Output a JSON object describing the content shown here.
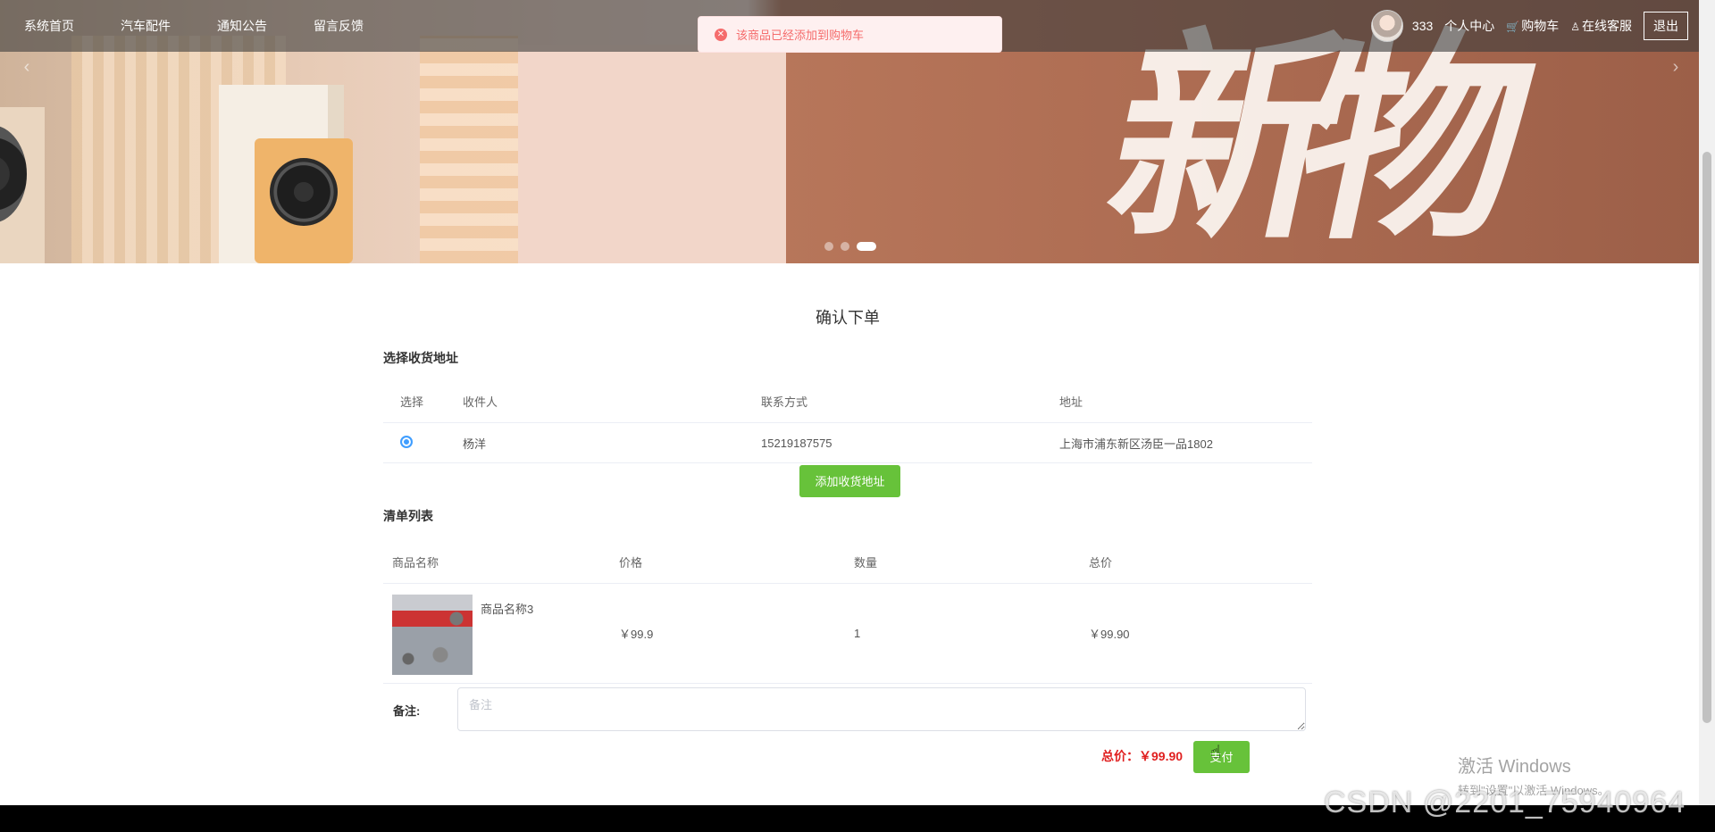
{
  "nav": {
    "menu": [
      "系统首页",
      "汽车配件",
      "通知公告",
      "留言反馈"
    ],
    "username": "333",
    "personal_center": "个人中心",
    "cart": "购物车",
    "service": "在线客服",
    "logout": "退出"
  },
  "toast": {
    "message": "该商品已经添加到购物车"
  },
  "page": {
    "title": "确认下单"
  },
  "address": {
    "section_title": "选择收货地址",
    "headers": [
      "选择",
      "收件人",
      "联系方式",
      "地址"
    ],
    "rows": [
      {
        "name": "杨洋",
        "phone": "15219187575",
        "address": "上海市浦东新区汤臣一品1802"
      }
    ],
    "add_button": "添加收货地址"
  },
  "items": {
    "section_title": "清单列表",
    "headers": [
      "商品名称",
      "价格",
      "数量",
      "总价"
    ],
    "rows": [
      {
        "name": "商品名称3",
        "price": "￥99.9",
        "qty": "1",
        "subtotal": "￥99.90"
      }
    ]
  },
  "remark": {
    "label": "备注:",
    "placeholder": "备注"
  },
  "summary": {
    "total": "总价：￥99.90",
    "pay_button": "支付"
  },
  "watermark": {
    "windows_line1": "激活 Windows",
    "windows_line2": "转到\"设置\"以激活 Windows。",
    "csdn": "CSDN @2201_75940964"
  },
  "colors": {
    "accent_green": "#67c23a",
    "price_red": "#e02020",
    "toast_red": "#f56c6c",
    "radio_blue": "#409eff"
  }
}
